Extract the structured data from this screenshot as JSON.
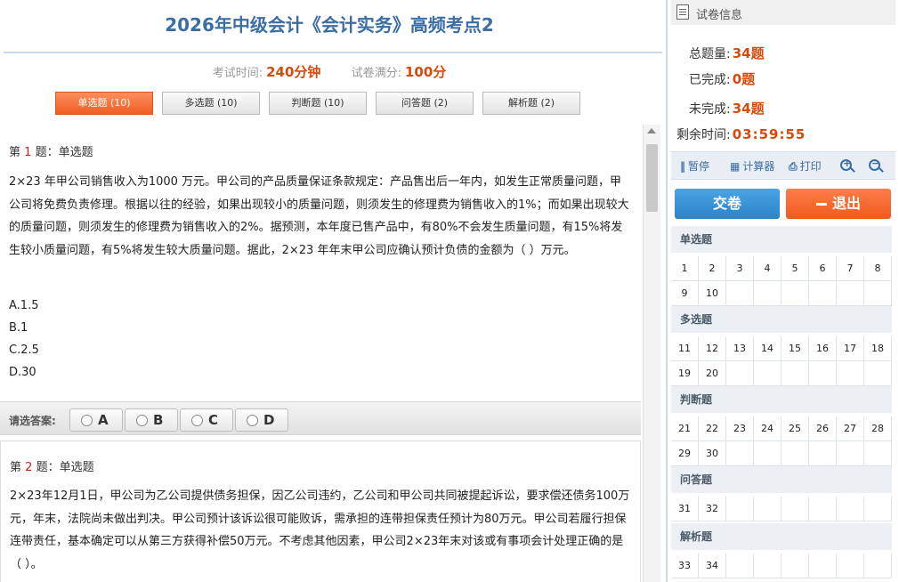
{
  "header": {
    "title": "2026年中级会计《会计实务》高频考点2",
    "time_label": "考试时间:",
    "time_value": "240分钟",
    "score_label": "试卷满分:",
    "score_value": "100分"
  },
  "tabs": [
    {
      "label": "单选题 (10)",
      "active": true
    },
    {
      "label": "多选题 (10)",
      "active": false
    },
    {
      "label": "判断题 (10)",
      "active": false
    },
    {
      "label": "问答题 (2)",
      "active": false
    },
    {
      "label": "解析题 (2)",
      "active": false
    }
  ],
  "questions": [
    {
      "prefix": "第",
      "number": "1",
      "suffix": "题：单选题",
      "text": "2×23 年甲公司销售收入为1000 万元。甲公司的产品质量保证条款规定：产品售出后一年内，如发生正常质量问题，甲公司将免费负责修理。根据以往的经验，如果出现较小的质量问题，则须发生的修理费为销售收入的1%；而如果出现较大的质量问题，则须发生的修理费为销售收入的2%。据预测，本年度已售产品中，有80%不会发生质量问题，有15%将发生较小质量问题，有5%将发生较大质量问题。据此，2×23 年年末甲公司应确认预计负债的金额为（  ）万元。",
      "options": [
        "A.1.5",
        "B.1",
        "C.2.5",
        "D.30"
      ]
    },
    {
      "prefix": "第",
      "number": "2",
      "suffix": "题：单选题",
      "text": "2×23年12月1日，甲公司为乙公司提供债务担保，因乙公司违约，乙公司和甲公司共同被提起诉讼，要求偿还债务100万元，年末，法院尚未做出判决。甲公司预计该诉讼很可能败诉，需承担的连带担保责任预计为80万元。甲公司若履行担保连带责任，基本确定可以从第三方获得补偿50万元。不考虑其他因素，甲公司2×23年末对该或有事项会计处理正确的是（ ）。"
    }
  ],
  "answer_bar": {
    "label": "请选答案:",
    "choices": [
      "A",
      "B",
      "C",
      "D"
    ]
  },
  "sidebar": {
    "header": "试卷信息",
    "total_label": "总题量:",
    "total_value": "34题",
    "done_label": "已完成:",
    "done_value": "0题",
    "undone_label": "未完成:",
    "undone_value": "34题",
    "time_left_label": "剩余时间:",
    "time_left_value": "03:59:55",
    "tools": {
      "pause": "暂停",
      "calculator": "计算器",
      "print": "打印"
    },
    "submit": "交卷",
    "exit": "退出",
    "sections": [
      {
        "name": "单选题",
        "items": [
          "1",
          "2",
          "3",
          "4",
          "5",
          "6",
          "7",
          "8",
          "9",
          "10"
        ]
      },
      {
        "name": "多选题",
        "items": [
          "11",
          "12",
          "13",
          "14",
          "15",
          "16",
          "17",
          "18",
          "19",
          "20"
        ]
      },
      {
        "name": "判断题",
        "items": [
          "21",
          "22",
          "23",
          "24",
          "25",
          "26",
          "27",
          "28",
          "29",
          "30"
        ]
      },
      {
        "name": "问答题",
        "items": [
          "31",
          "32"
        ]
      },
      {
        "name": "解析题",
        "items": [
          "33",
          "34"
        ]
      }
    ]
  },
  "colors": {
    "accent_orange": "#f25d22",
    "title_blue": "#3b6ea5",
    "submit_blue": "#2a84c8",
    "question_number_red": "#d8191a"
  }
}
